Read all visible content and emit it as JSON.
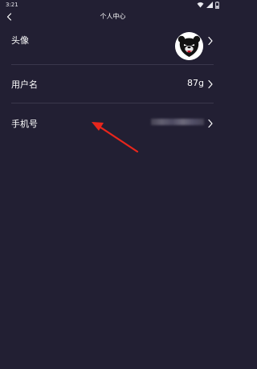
{
  "status_bar": {
    "time": "3:21",
    "icons": [
      "wifi-icon",
      "signal-icon",
      "battery-icon"
    ]
  },
  "header": {
    "title": "个人中心",
    "back_icon": "chevron-left-icon"
  },
  "rows": [
    {
      "label": "头像",
      "kind": "avatar"
    },
    {
      "label": "用户名",
      "value": "87g"
    },
    {
      "label": "手机号",
      "value": ""
    }
  ],
  "annotation": {
    "icon": "red-arrow-icon",
    "color": "#e8261c"
  },
  "colors": {
    "background": "#221f33",
    "divider": "#3a374c",
    "text": "#ffffff"
  }
}
